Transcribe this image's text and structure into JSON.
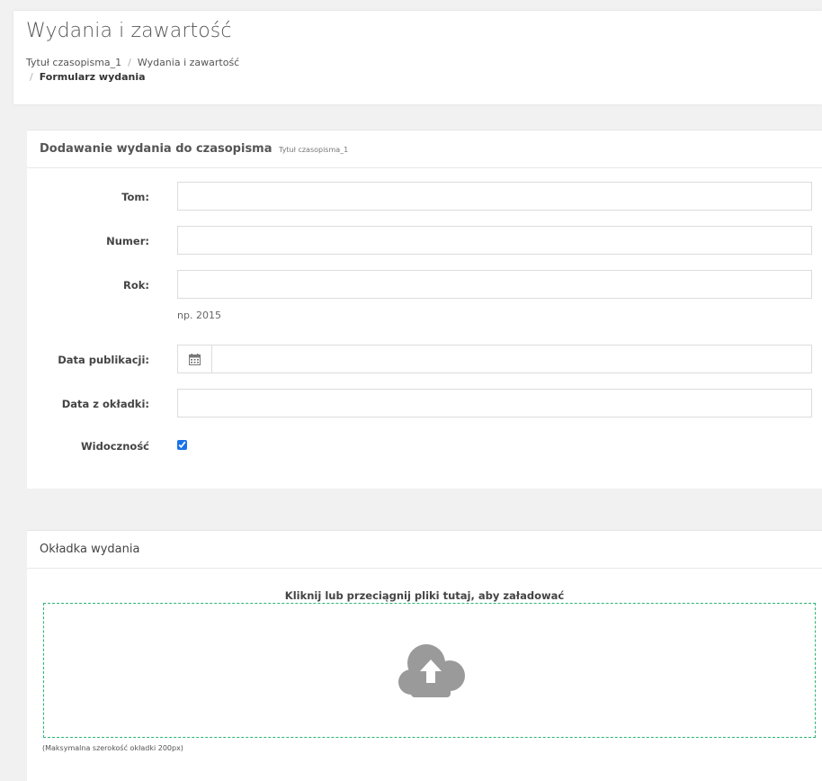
{
  "header": {
    "title": "Wydania i zawartość",
    "breadcrumb": {
      "item1": "Tytuł czasopisma_1",
      "item2": "Wydania i zawartość",
      "separator": "/",
      "current": "Formularz wydania"
    }
  },
  "issue_form": {
    "title": "Dodawanie wydania do czasopisma",
    "journal_name": "Tytuł czasopisma_1",
    "fields": {
      "volume": {
        "label": "Tom:",
        "value": ""
      },
      "number": {
        "label": "Numer:",
        "value": ""
      },
      "year": {
        "label": "Rok:",
        "value": "",
        "help": "np. 2015"
      },
      "publication_date": {
        "label": "Data publikacji:",
        "value": "",
        "icon": "calendar-icon"
      },
      "cover_date": {
        "label": "Data z okładki:",
        "value": ""
      },
      "visibility": {
        "label": "Widoczność",
        "checked": true
      }
    }
  },
  "cover": {
    "title": "Okładka wydania",
    "dropzone_text": "Kliknij lub przeciągnij pliki tutaj, aby załadować",
    "icon": "cloud-upload-icon",
    "note": "(Maksymalna szerokość okładki 200px)"
  },
  "colors": {
    "dropzone_border": "#2bb673",
    "checkbox": "#1a73e8",
    "icon_gray": "#9a9a9a"
  }
}
